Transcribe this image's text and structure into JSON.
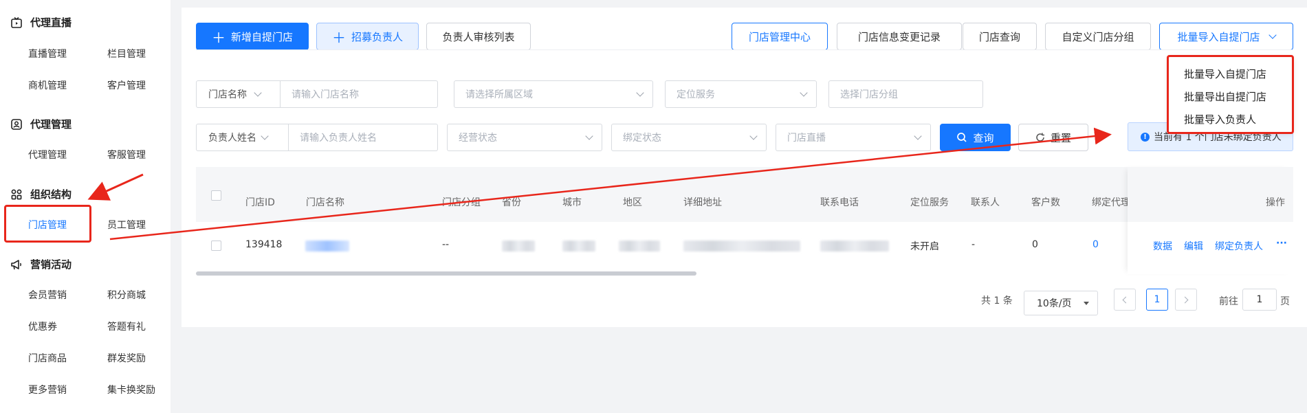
{
  "sidebar": {
    "groups": [
      {
        "label": "代理直播",
        "icon": "live-tv-icon",
        "items": [
          "直播管理",
          "栏目管理",
          "商机管理",
          "客户管理"
        ]
      },
      {
        "label": "代理管理",
        "icon": "id-card-icon",
        "items": [
          "代理管理",
          "客服管理"
        ]
      },
      {
        "label": "组织结构",
        "icon": "grid-apps-icon",
        "items": [
          "门店管理",
          "员工管理"
        ]
      },
      {
        "label": "营销活动",
        "icon": "megaphone-icon",
        "items": [
          "会员营销",
          "积分商城",
          "优惠券",
          "答题有礼",
          "门店商品",
          "群发奖励",
          "更多营销",
          "集卡换奖励"
        ]
      }
    ],
    "active_item": "门店管理"
  },
  "toolbar": {
    "add_store": "新增自提门店",
    "recruit_owner": "招募负责人",
    "owner_review": "负责人审核列表",
    "store_center": "门店管理中心",
    "change_log": "门店信息变更记录",
    "store_query": "门店查询",
    "custom_group": "自定义门店分组",
    "batch_import": "批量导入自提门店"
  },
  "dropdown": {
    "items": [
      "批量导入自提门店",
      "批量导出自提门店",
      "批量导入负责人"
    ]
  },
  "filters": {
    "store_name_select": "门店名称",
    "store_name_placeholder": "请输入门店名称",
    "region_placeholder": "请选择所属区域",
    "location_placeholder": "定位服务",
    "group_placeholder": "选择门店分组",
    "owner_select": "负责人姓名",
    "owner_placeholder": "请输入负责人姓名",
    "biz_status_placeholder": "经营状态",
    "bind_status_placeholder": "绑定状态",
    "live_placeholder": "门店直播",
    "search_button": "查询",
    "reset_button": "重置"
  },
  "notice": "当前有 1 个门店未绑定负责人",
  "table": {
    "headers": [
      "门店ID",
      "门店名称",
      "门店分组",
      "省份",
      "城市",
      "地区",
      "详细地址",
      "联系电话",
      "定位服务",
      "联系人",
      "客户数",
      "绑定代理",
      "操作"
    ],
    "rows": [
      {
        "id": "139418",
        "group": "--",
        "location_service": "未开启",
        "contact": "-",
        "customers": "0",
        "bound_agent": "0",
        "actions": [
          "数据",
          "编辑",
          "绑定负责人",
          "···"
        ]
      }
    ]
  },
  "pagination": {
    "total": "共 1 条",
    "page_size": "10条/页",
    "current_page": "1",
    "goto_label": "前往",
    "goto_value": "1",
    "page_unit": "页"
  },
  "colors": {
    "primary": "#1677ff",
    "annotation_red": "#e8261b"
  }
}
